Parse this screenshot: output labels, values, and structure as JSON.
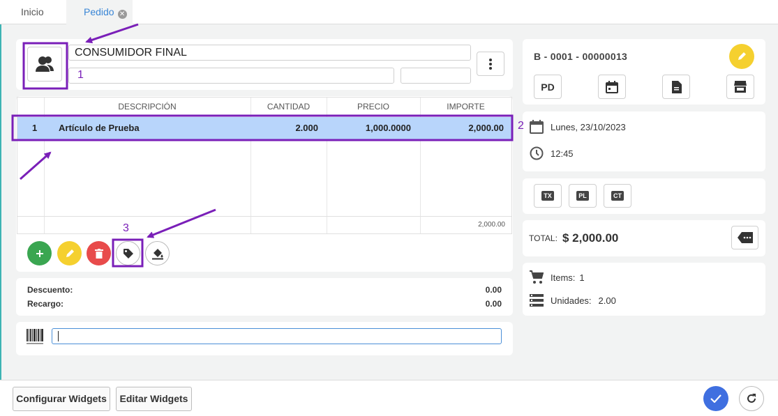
{
  "tabs": [
    {
      "label": "Inicio"
    },
    {
      "label": "Pedido",
      "active": true
    }
  ],
  "customer": {
    "name": "CONSUMIDOR FINAL",
    "field2": "",
    "field3": ""
  },
  "table": {
    "columns": [
      "DESCRIPCIÓN",
      "CANTIDAD",
      "PRECIO",
      "IMPORTE"
    ],
    "rows": [
      {
        "num": "1",
        "descripcion": "Artículo de Prueba",
        "cantidad": "2.000",
        "precio": "1,000.0000",
        "importe": "2,000.00"
      }
    ],
    "footer_total": "2,000.00"
  },
  "adjustments": {
    "descuento_label": "Descuento:",
    "descuento_value": "0.00",
    "recargo_label": "Recargo:",
    "recargo_value": "0.00"
  },
  "barcode": {
    "value": ""
  },
  "document": {
    "number": "B - 0001 - 00000013",
    "type_label": "PD"
  },
  "datetime": {
    "date": "Lunes, 23/10/2023",
    "time": "12:45"
  },
  "codes": [
    "TX",
    "PL",
    "CT"
  ],
  "totals": {
    "label": "TOTAL:",
    "value": "$ 2,000.00"
  },
  "stats": {
    "items_label": "Items:",
    "items_value": "1",
    "units_label": "Unidades:",
    "units_value": "2.00"
  },
  "bottom": {
    "config_label": "Configurar Widgets",
    "edit_label": "Editar Widgets"
  },
  "annotations": {
    "n1": "1",
    "n2": "2",
    "n3": "3",
    "color": "#7a1fb8"
  },
  "colors": {
    "accent_blue": "#3a86d6",
    "row_selected": "#b8d5fb",
    "add_green": "#3aa651",
    "edit_yellow": "#f5d02f",
    "delete_red": "#e84b4b",
    "confirm_blue": "#3f6fe0"
  },
  "icons": {
    "users": "users-icon",
    "more": "more-vertical-icon",
    "plus": "plus-icon",
    "pencil": "pencil-icon",
    "trash": "trash-icon",
    "tag": "tag-icon",
    "fill": "paint-bucket-icon",
    "barcode": "barcode-icon",
    "calendar": "calendar-icon",
    "document": "document-icon",
    "store": "store-icon",
    "clock": "clock-icon",
    "backspace": "backspace-icon",
    "cart": "cart-icon",
    "list": "list-icon",
    "check": "check-icon",
    "refresh": "refresh-icon"
  }
}
